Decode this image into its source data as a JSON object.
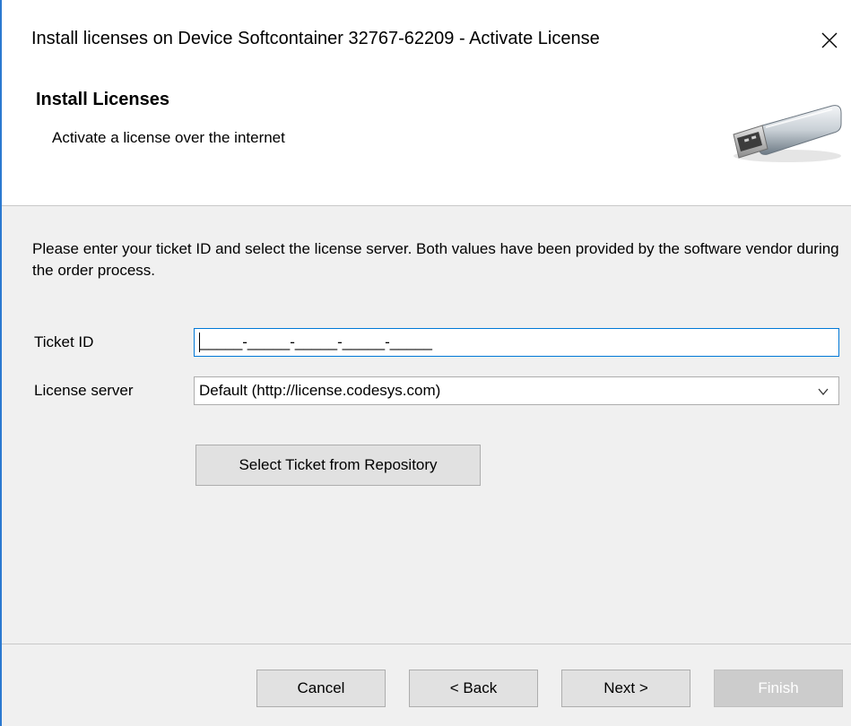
{
  "window": {
    "title": "Install licenses on Device Softcontainer 32767-62209 - Activate License",
    "close_glyph": "✕"
  },
  "header": {
    "title": "Install Licenses",
    "subtitle": "Activate a license over the internet",
    "icon": "usb-stick-icon"
  },
  "content": {
    "instructions": "Please enter your ticket ID and select the license server. Both values have been provided by the software vendor during the order process.",
    "ticket_id": {
      "label": "Ticket ID",
      "value": "_____-_____-_____-_____-_____"
    },
    "license_server": {
      "label": "License server",
      "selected": "Default (http://license.codesys.com)"
    },
    "repository_button": "Select Ticket from Repository"
  },
  "footer": {
    "cancel": "Cancel",
    "back": "< Back",
    "next": "Next >",
    "finish": "Finish"
  },
  "colors": {
    "accent": "#0078d7",
    "panel_bg": "#f0f0f0",
    "button_bg": "#e1e1e1",
    "disabled_bg": "#cccccc"
  }
}
